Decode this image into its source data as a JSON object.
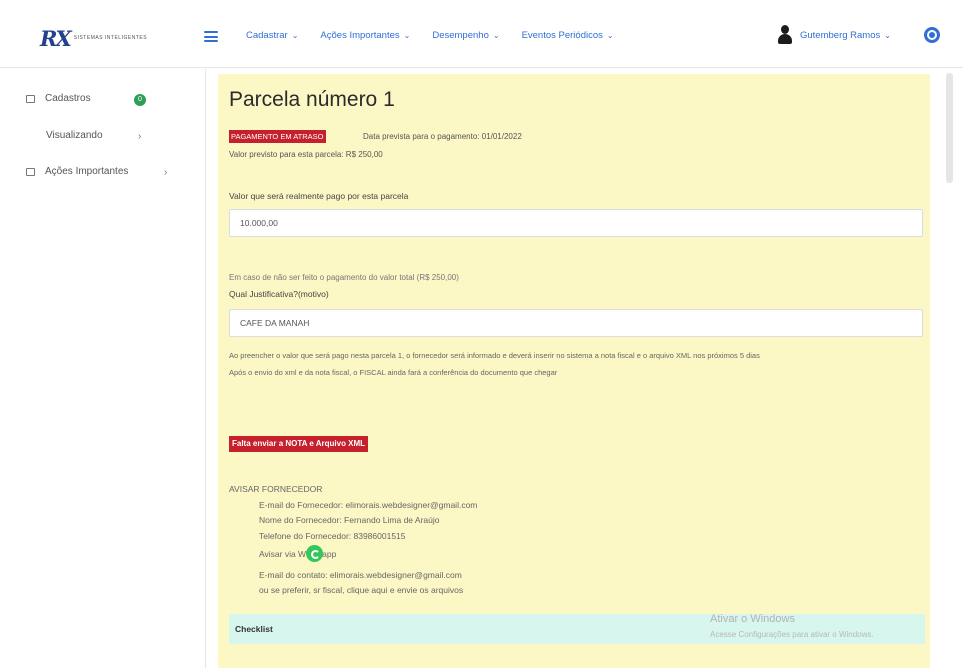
{
  "brand": {
    "letters": "RX",
    "tagline": "Sistemas Inteligentes"
  },
  "nav": {
    "items": [
      {
        "label": "Cadastrar"
      },
      {
        "label": "Ações Importantes"
      },
      {
        "label": "Desempenho"
      },
      {
        "label": "Eventos Periódicos"
      }
    ],
    "caret": "⌄"
  },
  "user": {
    "name": "Gutemberg Ramos"
  },
  "sidebar": {
    "items": [
      {
        "label": "Cadastros",
        "badge": "0"
      },
      {
        "label": "Visualizando",
        "chevron": "›"
      },
      {
        "label": "Ações Importantes",
        "chevron": "›"
      }
    ]
  },
  "page": {
    "title": "Parcela número 1",
    "status_tag": "PAGAMENTO EM ATRASO",
    "expected_date": "Data prevista para o pagamento: 01/01/2022",
    "expected_value": "Valor previsto para esta parcela: R$ 250,00",
    "paid_label": "Valor que será realmente pago por esta parcela",
    "paid_value": "10.000,00",
    "partial_note": "Em caso de não ser feito o pagamento do valor total (R$ 250,00)",
    "justification_label": "Qual Justificativa?(motivo)",
    "justification_value": "CAFE DA MANAH",
    "info_line1": "Ao preencher o valor que será pago nesta parcela 1, o fornecedor será informado e deverá inserir no sistema a nota fiscal e o arquivo XML nos próximos 5 dias",
    "info_line2": "Após o envio do xml e da nota fiscal, o FISCAL ainda fará a conferência do documento que chegar",
    "missing_tag": "Falta enviar a NOTA e Arquivo XML",
    "supplier": {
      "heading": "AVISAR FORNECEDOR",
      "email": "E-mail do Fornecedor: elimorais.webdesigner@gmail.com",
      "name": "Nome do Fornecedor: Fernando Lima de Araújo",
      "phone": "Telefone do Fornecedor: 83986001515",
      "whatsapp": "Avisar via Whatsapp",
      "contact_email": "E-mail do contato: elimorais.webdesigner@gmail.com",
      "fiscal_link": "ou se preferir, sr fiscal, clique aqui e envie os arquivos"
    },
    "checklist_label": "Checklist"
  },
  "watermark": {
    "line1": "Ativar o Windows",
    "line2": "Acesse Configurações para ativar o Windows."
  }
}
